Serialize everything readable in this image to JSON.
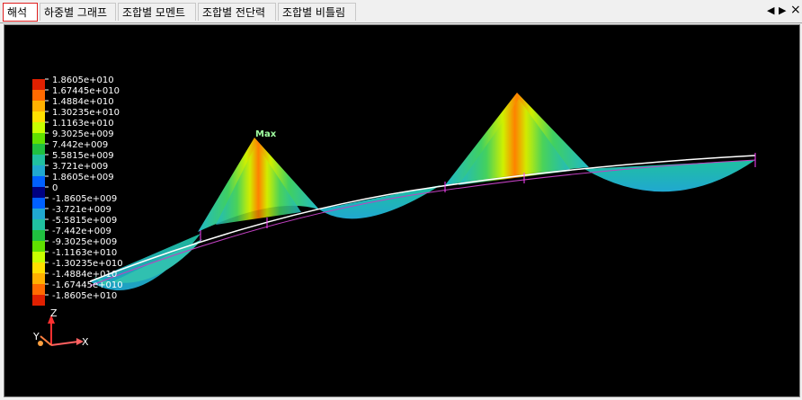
{
  "tabs": [
    {
      "label": "해석",
      "active": true
    },
    {
      "label": "하중별 그래프",
      "active": false
    },
    {
      "label": "조합별 모멘트",
      "active": false
    },
    {
      "label": "조합별 전단력",
      "active": false
    },
    {
      "label": "조합별 비틀림",
      "active": false
    }
  ],
  "nav": {
    "prev_icon": "◀",
    "next_icon": "▶",
    "close_icon": "×"
  },
  "legend": {
    "values": [
      "1.8605e+010",
      "1.67445e+010",
      "1.4884e+010",
      "1.30235e+010",
      "1.1163e+010",
      "9.3025e+009",
      "7.442e+009",
      "5.5815e+009",
      "3.721e+009",
      "1.8605e+009",
      "0",
      "-1.8605e+009",
      "-3.721e+009",
      "-5.5815e+009",
      "-7.442e+009",
      "-9.3025e+009",
      "-1.1163e+010",
      "-1.30235e+010",
      "-1.4884e+010",
      "-1.67445e+010",
      "-1.8605e+010"
    ],
    "colors": [
      "#e02000",
      "#ff6a00",
      "#ffb000",
      "#ffe000",
      "#c8ff00",
      "#60e000",
      "#20c040",
      "#20c0a0",
      "#20a8d0",
      "#0060ff",
      "#000080",
      "#0060ff",
      "#20a8d0",
      "#20c0a0",
      "#20c040",
      "#60e000",
      "#c8ff00",
      "#ffe000",
      "#ffb000",
      "#ff6a00",
      "#e02000"
    ]
  },
  "annotation": {
    "max_label": "Max"
  },
  "axes": {
    "z": "Z",
    "y": "Y",
    "x": "X"
  }
}
